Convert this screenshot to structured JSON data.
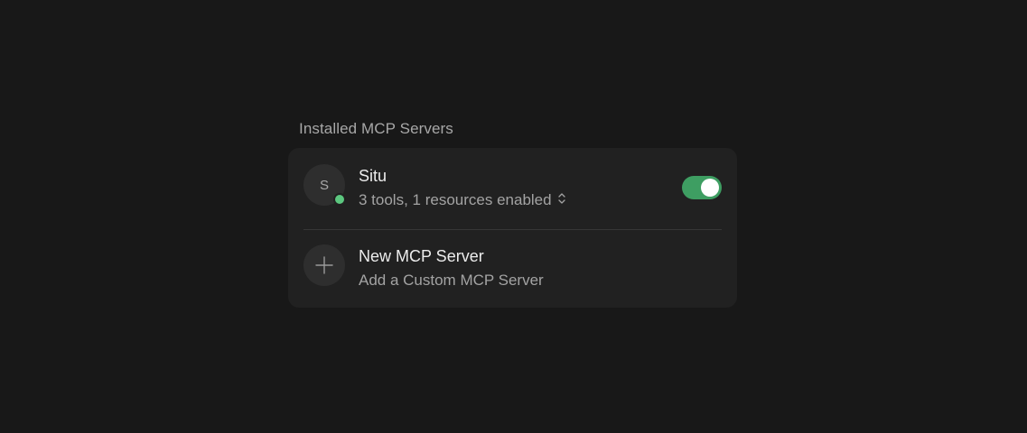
{
  "section": {
    "title": "Installed MCP Servers"
  },
  "servers": [
    {
      "avatar_letter": "S",
      "name": "Situ",
      "summary": "3 tools, 1 resources enabled",
      "status": "connected",
      "enabled": true,
      "status_color": "#5cc77f",
      "toggle_color": "#3e9e62"
    }
  ],
  "add_server": {
    "title": "New MCP Server",
    "subtitle": "Add a Custom MCP Server",
    "icon": "plus-icon"
  },
  "colors": {
    "background": "#181818",
    "card": "#212121"
  }
}
